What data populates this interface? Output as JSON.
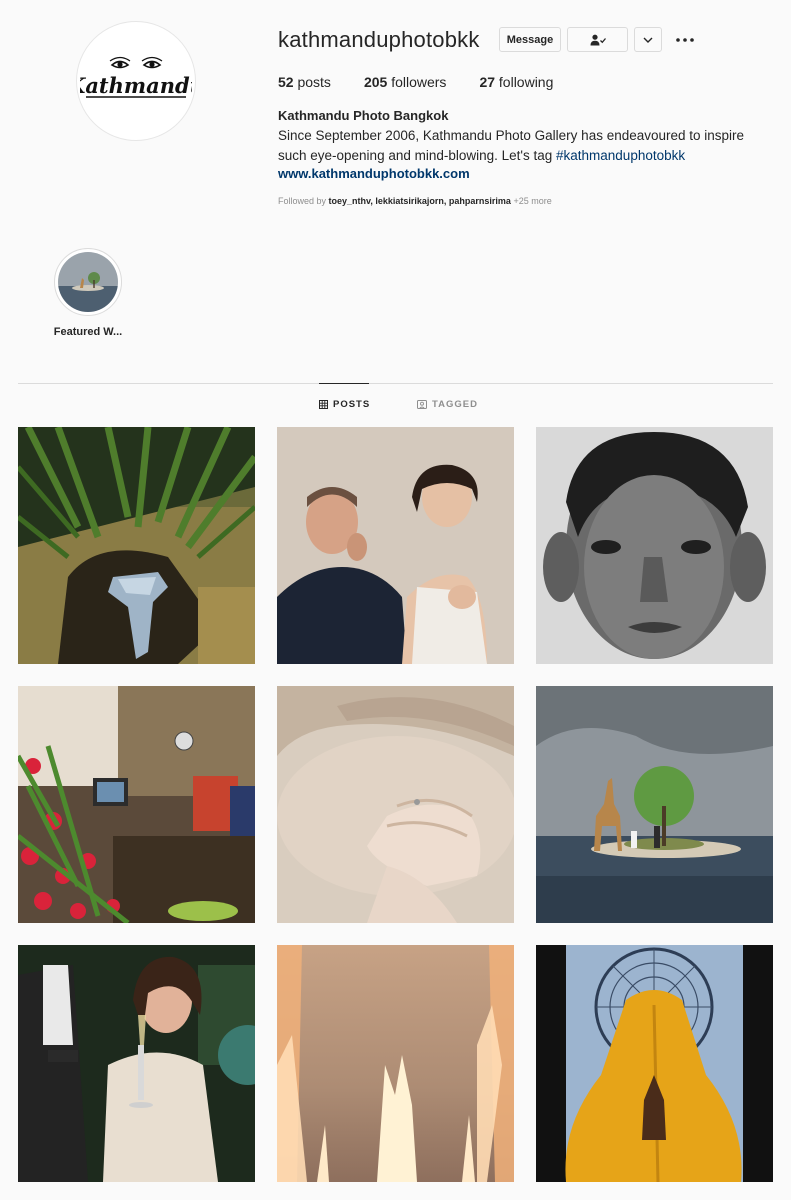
{
  "profile": {
    "username": "kathmanduphotobkk",
    "logo_text": "Kathmandu",
    "message_label": "Message",
    "stats": {
      "posts_count": "52",
      "posts_label": "posts",
      "followers_count": "205",
      "followers_label": "followers",
      "following_count": "27",
      "following_label": "following"
    },
    "full_name": "Kathmandu Photo Bangkok",
    "bio_text": "Since September 2006, Kathmandu Photo Gallery has endeavoured to inspire such eye-opening and mind-blowing. Let's tag ",
    "bio_hashtag": "#kathmanduphotobkk",
    "website": "www.kathmanduphotobkk.com",
    "followed_by_prefix": "Followed by ",
    "followed_by_names": "toey_nthv, lekkiatsirikajorn, pahparnsirima",
    "followed_by_more": " +25 more"
  },
  "highlights": [
    {
      "label": "Featured W..."
    }
  ],
  "tabs": {
    "posts": "POSTS",
    "tagged": "TAGGED"
  },
  "posts": [
    {
      "subject": "palm shadow with animal skull"
    },
    {
      "subject": "man and woman portrait"
    },
    {
      "subject": "black and white boy portrait"
    },
    {
      "subject": "shop interior with flowers"
    },
    {
      "subject": "close-up hand on skin"
    },
    {
      "subject": "giraffe on small island"
    },
    {
      "subject": "woman holding champagne"
    },
    {
      "subject": "abstract light streaks"
    },
    {
      "subject": "figure in yellow cloth with fan halo"
    }
  ],
  "colors": {
    "link": "#00376b",
    "border": "#dbdbdb",
    "muted": "#8e8e8e"
  }
}
